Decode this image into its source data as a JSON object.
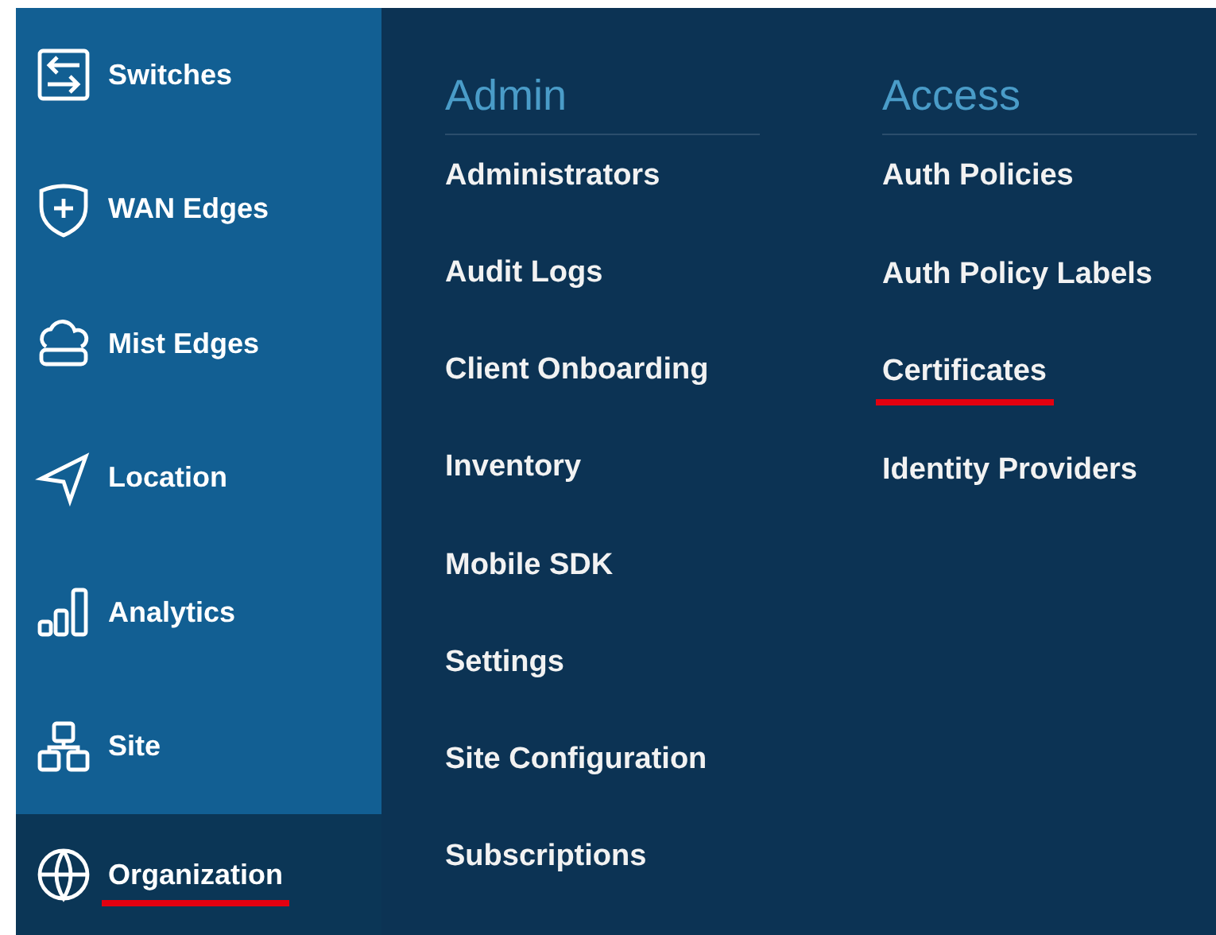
{
  "sidebar": {
    "items": [
      {
        "label": "Switches",
        "kind": "switches",
        "selected": false,
        "highlighted": false
      },
      {
        "label": "WAN Edges",
        "kind": "shield",
        "selected": false,
        "highlighted": false
      },
      {
        "label": "Mist Edges",
        "kind": "cloud",
        "selected": false,
        "highlighted": false
      },
      {
        "label": "Location",
        "kind": "location",
        "selected": false,
        "highlighted": false
      },
      {
        "label": "Analytics",
        "kind": "analytics",
        "selected": false,
        "highlighted": false
      },
      {
        "label": "Site",
        "kind": "site",
        "selected": false,
        "highlighted": false
      },
      {
        "label": "Organization",
        "kind": "globe",
        "selected": true,
        "highlighted": true
      }
    ]
  },
  "menu": {
    "columns": [
      {
        "heading": "Admin",
        "items": [
          {
            "label": "Administrators",
            "highlighted": false
          },
          {
            "label": "Audit Logs",
            "highlighted": false
          },
          {
            "label": "Client Onboarding",
            "highlighted": false
          },
          {
            "label": "Inventory",
            "highlighted": false
          },
          {
            "label": "Mobile SDK",
            "highlighted": false
          },
          {
            "label": "Settings",
            "highlighted": false
          },
          {
            "label": "Site Configuration",
            "highlighted": false
          },
          {
            "label": "Subscriptions",
            "highlighted": false
          }
        ]
      },
      {
        "heading": "Access",
        "items": [
          {
            "label": "Auth Policies",
            "highlighted": false
          },
          {
            "label": "Auth Policy Labels",
            "highlighted": false
          },
          {
            "label": "Certificates",
            "highlighted": true
          },
          {
            "label": "Identity Providers",
            "highlighted": false
          }
        ]
      }
    ]
  }
}
